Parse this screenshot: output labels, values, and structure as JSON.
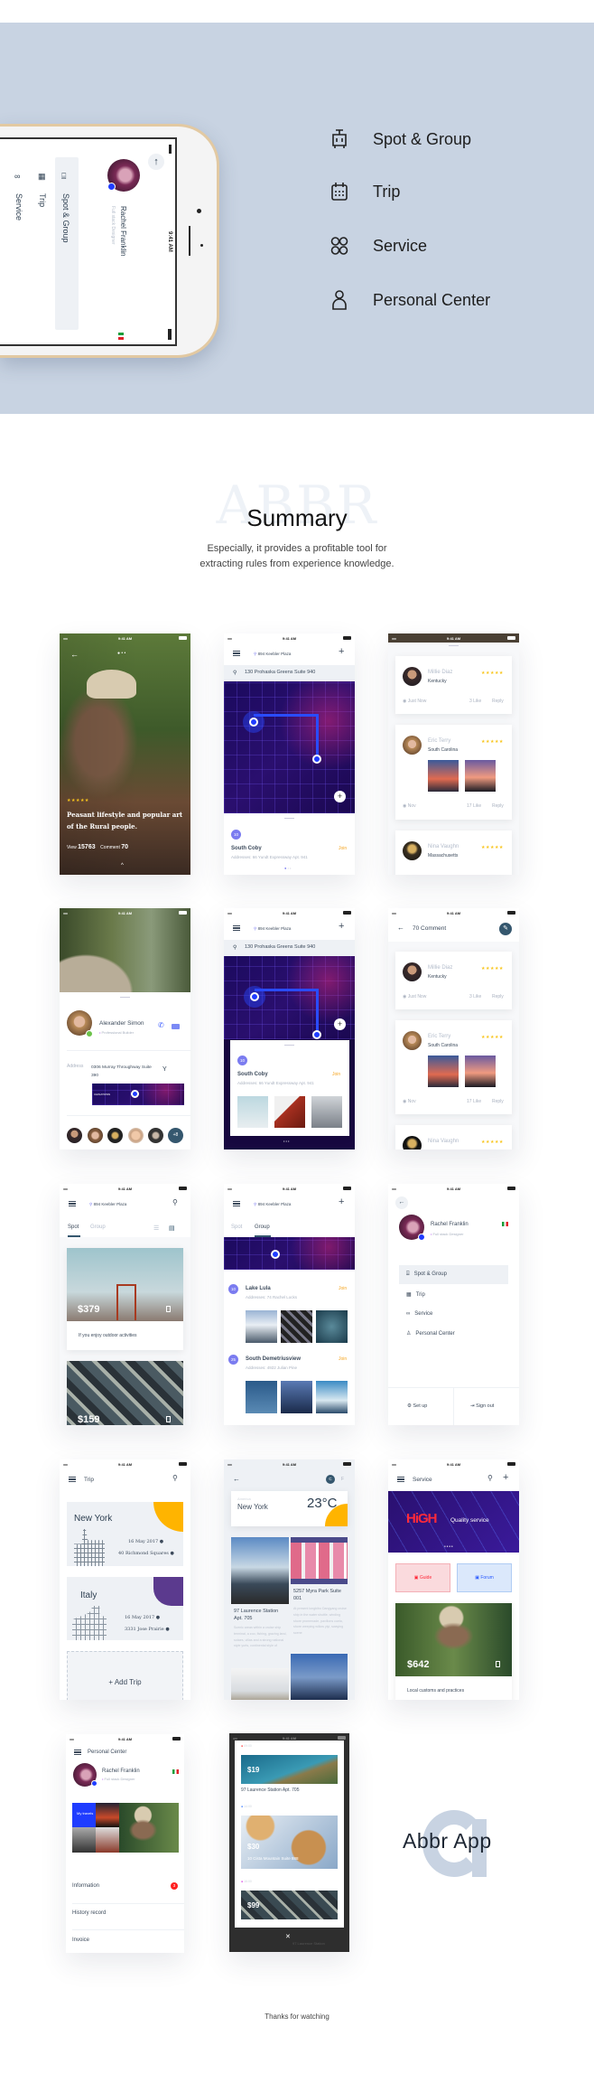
{
  "status_time": "9:41 AM",
  "hero": {
    "phone": {
      "status_time": "9:41 AM",
      "user_name": "Rachel Franklin",
      "user_role": "Full stack Designer",
      "menu": [
        "Spot & Group",
        "Trip",
        "Service"
      ]
    },
    "menu": [
      {
        "label": "Spot & Group",
        "icon": "luggage-icon"
      },
      {
        "label": "Trip",
        "icon": "calendar-icon"
      },
      {
        "label": "Service",
        "icon": "grid-circles-icon"
      },
      {
        "label": "Personal Center",
        "icon": "person-icon"
      }
    ],
    "band_color": "#c8d3e2"
  },
  "summary": {
    "watermark": "ABBR",
    "title": "Summary",
    "description_line1": "Especially, it provides a profitable tool for",
    "description_line2": "extracting rules from experience knowledge."
  },
  "screens": {
    "article": {
      "rating": "★★★★★",
      "title_line1": "Peasant lifestyle and popular art",
      "title_line2": "of the Rural people.",
      "view_label": "View",
      "view_count": "15763",
      "comment_label": "Comment",
      "comment_count": "70"
    },
    "map": {
      "location": "894 Keebler Plaza",
      "address": "130 Prohaska Greens Suite 940",
      "spot_badge": "10",
      "spot_name": "South Coby",
      "join": "Join",
      "spot_address": "Addresses: 66 Yundt Expressway Apt. 941"
    },
    "comments": {
      "title": "70 Comment",
      "items": [
        {
          "name": "Millie Diaz",
          "place": "Kentucky",
          "stars": "★★★★★",
          "time": "Just Now",
          "likes": "3 Like",
          "reply": "Reply"
        },
        {
          "name": "Eric Terry",
          "place": "South Carolina",
          "stars": "★★★★★",
          "time": "Nov",
          "likes": "17 Like",
          "reply": "Reply"
        },
        {
          "name": "Nina Vaughn",
          "place": "Massachusetts",
          "stars": "★★★★★"
        }
      ]
    },
    "profile": {
      "name": "Alexander Simon",
      "role": "Professional Builder",
      "address_label": "Address",
      "address_line1": "0306 Murray Throughway Suite",
      "address_line2": "390",
      "map_label": "CHINATOWN",
      "more_count": "+8"
    },
    "spot_list": {
      "location": "894 Keebler Plaza",
      "tab_spot": "Spot",
      "tab_group": "Group",
      "price1": "$379",
      "caption1": "If you enjoy outdoor activities",
      "price2": "$159"
    },
    "group_list": {
      "location": "894 Keebler Plaza",
      "tab_spot": "Spot",
      "tab_group": "Group",
      "items": [
        {
          "badge": "10",
          "name": "Lake Lula",
          "address": "Addresses: 74 Rachel Locks",
          "join": "Join"
        },
        {
          "badge": "25",
          "name": "South Demetriusview",
          "address": "Addresses: 4922 Julian Pine",
          "join": "Join"
        }
      ]
    },
    "drawer": {
      "name": "Rachel Franklin",
      "role": "Full stack Designer",
      "menu": [
        "Spot & Group",
        "Trip",
        "Service",
        "Personal Center"
      ],
      "setup": "Set up",
      "signout": "Sign out"
    },
    "trip": {
      "title": "Trip",
      "trips": [
        {
          "city": "New York",
          "date": "16 May 2017",
          "place": "40 Richmond Squares",
          "color": "#ffb400"
        },
        {
          "city": "Italy",
          "date": "16 May 2017",
          "place": "3331 Jose Prairie",
          "color": "#5b3a8e"
        }
      ],
      "add": "+ Add Trip"
    },
    "weather": {
      "unit_c": "C",
      "unit_f": "F",
      "country": "America",
      "city": "New York",
      "temp": "23°C",
      "post1_title": "97 Laurence Station Apt. 705",
      "post1_desc": "Scenic areas within a cruise ship terminal, a zoo, fishing, grazing land, sotaes, villas and a strong national style yurts, continental style of",
      "post2_title": "5257 Myra Park Suite 001",
      "post2_desc": "At present longbibo Dangyang cruise ship in the water shuttle, winding shore promenade, pavilions cuela, shore weeping willow yiyi, swaying scene"
    },
    "service": {
      "title": "Service",
      "banner_big": "HiGH",
      "banner_small": "Quality service",
      "guide": "Guide",
      "forum": "Forum",
      "price": "$642",
      "caption": "Local customs and practices"
    },
    "personal": {
      "title": "Personal Center",
      "name": "Rachel Franklin",
      "role": "Full stack Designer",
      "tile": "My travels",
      "items": [
        "Information",
        "History record",
        "Invoice"
      ],
      "info_badge": "3"
    },
    "timeline": {
      "entries": [
        {
          "time": "09:00",
          "price": "$19",
          "title": "97 Laurence Station Apt. 705",
          "dot": "#ff2020"
        },
        {
          "time": "14:00",
          "price": "$30",
          "title": "10 Cista Mountain Suite 888",
          "dot": "#1f6bff"
        },
        {
          "time": "16:00",
          "price": "$99",
          "dot": "#d020e0"
        }
      ],
      "behind_text": "97 Laurence Station"
    }
  },
  "logo": {
    "text": "Abbr App"
  },
  "footer": {
    "thanks": "Thanks for watching"
  }
}
